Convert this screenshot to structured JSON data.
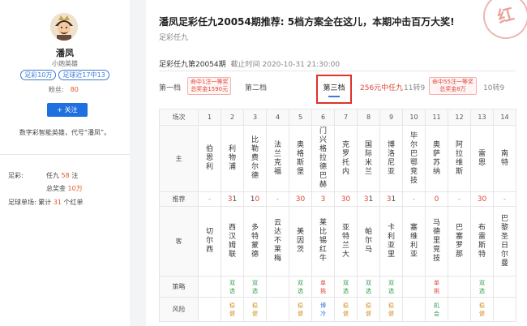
{
  "profile": {
    "name": "潘凤",
    "title": "小炮英雄",
    "badges": [
      "足彩10万",
      "足球近17中13"
    ],
    "fans_label": "粉丝:",
    "fans_count": "80",
    "follow_label": "+ 关注",
    "description": "数字彩智能英雄，代号“潘凤”。",
    "stats": [
      {
        "label": "足彩:",
        "prefix": "任九",
        "value": "58",
        "suffix": "注"
      },
      {
        "label": "",
        "prefix": "总奖金",
        "value": "10万",
        "suffix": ""
      },
      {
        "label": "足球单场:",
        "prefix": "累计",
        "value": "31",
        "suffix": "个红单"
      }
    ]
  },
  "article": {
    "title": "潘凤足彩任九20054期推荐: 5档方案全在这儿，本期冲击百万大奖!",
    "subtitle": "足彩任九",
    "stamp": "红",
    "issue": "足彩任九第20054期",
    "deadline": "截止时间 2020-10-31 21:30:00"
  },
  "tiers": {
    "t1": "第一档",
    "t1_badge_l1": "命中1注一等奖",
    "t1_badge_l2": "总奖金1590元",
    "t2": "第二档",
    "t3": "第三档",
    "t3_info": "256元中任九",
    "t3_sub": "11转9",
    "t4_badge_l1": "命中55注一等奖",
    "t4_badge_l2": "总奖金8万",
    "t4_sub": "10转9"
  },
  "table": {
    "row_labels": {
      "match": "场次",
      "home": "主",
      "pick": "推荐",
      "away": "客",
      "strategy": "策略",
      "risk": "风险"
    },
    "matches": [
      {
        "no": "1",
        "home": "伯恩利",
        "pick": "-",
        "away": "切尔西",
        "strategy": "",
        "risk": ""
      },
      {
        "no": "2",
        "home": "利物浦",
        "pick": "31",
        "away": "西汉姆联",
        "strategy": "双选",
        "risk": "稳健"
      },
      {
        "no": "3",
        "home": "比勒费尔德",
        "pick": "10",
        "away": "多特蒙德",
        "strategy": "双选",
        "risk": "稳健"
      },
      {
        "no": "4",
        "home": "法兰克福",
        "pick": "-",
        "away": "云达不莱梅",
        "strategy": "",
        "risk": ""
      },
      {
        "no": "5",
        "home": "奥格斯堡",
        "pick": "30",
        "away": "美因茨",
        "strategy": "双选",
        "risk": "稳健"
      },
      {
        "no": "6",
        "home": "门兴格拉德巴赫",
        "pick": "3",
        "away": "莱比锡红牛",
        "strategy": "单挑",
        "risk": "博冷"
      },
      {
        "no": "7",
        "home": "克罗托内",
        "pick": "30",
        "away": "亚特兰大",
        "strategy": "双选",
        "risk": "稳健"
      },
      {
        "no": "8",
        "home": "国际米兰",
        "pick": "31",
        "away": "帕尔马",
        "strategy": "双选",
        "risk": "稳健"
      },
      {
        "no": "9",
        "home": "博洛尼亚",
        "pick": "31",
        "away": "卡利亚里",
        "strategy": "双选",
        "risk": "稳健"
      },
      {
        "no": "10",
        "home": "毕尔巴鄂竞技",
        "pick": "-",
        "away": "塞维利亚",
        "strategy": "",
        "risk": ""
      },
      {
        "no": "11",
        "home": "奥萨苏纳",
        "pick": "0",
        "away": "马德里竞技",
        "strategy": "单挑",
        "risk": "机会"
      },
      {
        "no": "12",
        "home": "阿拉维斯",
        "pick": "-",
        "away": "巴塞罗那",
        "strategy": "",
        "risk": ""
      },
      {
        "no": "13",
        "home": "雷恩",
        "pick": "30",
        "away": "布雷斯特",
        "strategy": "双选",
        "risk": "稳健"
      },
      {
        "no": "14",
        "home": "南特",
        "pick": "-",
        "away": "巴黎圣日尔曼",
        "strategy": "",
        "risk": ""
      }
    ]
  },
  "colors": {
    "accent": "#1e6fe0",
    "red": "#e0453b",
    "green": "#2e9c4c",
    "orange": "#d7932a"
  }
}
